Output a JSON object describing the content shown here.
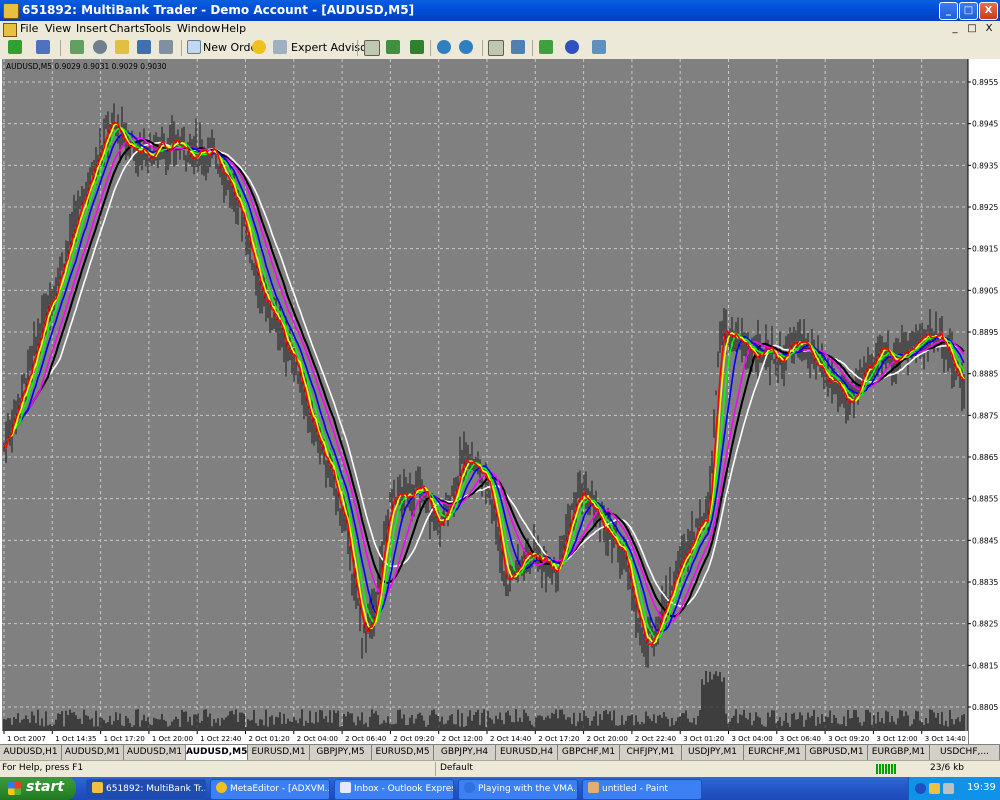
{
  "window": {
    "title": "651892: MultiBank Trader - Demo Account - [AUDUSD,M5]",
    "controls": [
      "_",
      "□",
      "X"
    ]
  },
  "menu": {
    "items": [
      "File",
      "View",
      "Insert",
      "Charts",
      "Tools",
      "Window",
      "Help"
    ],
    "mdi_controls": [
      "_",
      "□",
      "X"
    ]
  },
  "toolbar": {
    "new_order_label": "New Order",
    "expert_advisors_label": "Expert Advisors"
  },
  "chart": {
    "symbol_header": "AUDUSD,M5  0.9029 0.9031 0.9029 0.9030",
    "price_labels": [
      "0.8955",
      "0.8945",
      "0.8935",
      "0.8925",
      "0.8915",
      "0.8905",
      "0.8895",
      "0.8885",
      "0.8875",
      "0.8865",
      "0.8855",
      "0.8845",
      "0.8835",
      "0.8825",
      "0.8815",
      "0.8805"
    ],
    "time_labels": [
      "1 Oct 2007",
      "1 Oct 14:35",
      "1 Oct 17:20",
      "1 Oct 20:00",
      "1 Oct 22:40",
      "2 Oct 01:20",
      "2 Oct 04:00",
      "2 Oct 06:40",
      "2 Oct 09:20",
      "2 Oct 12:00",
      "2 Oct 14:40",
      "2 Oct 17:20",
      "2 Oct 20:00",
      "2 Oct 22:40",
      "3 Oct 01:20",
      "3 Oct 04:00",
      "3 Oct 06:40",
      "3 Oct 09:20",
      "3 Oct 12:00",
      "3 Oct 14:40"
    ],
    "colors": {
      "background": "#808080",
      "grid": "#c8c8c8",
      "candles": "#1a1a1a",
      "volume": "#282828",
      "ma_lines": [
        "#ffffff",
        "#000000",
        "#ff00ff",
        "#0000ff",
        "#00ff00",
        "#ffff00",
        "#ff0000"
      ]
    }
  },
  "tabs": [
    "AUDUSD,H1",
    "AUDUSD,M1",
    "AUDUSD,M1",
    "AUDUSD,M5",
    "EURUSD,M1",
    "GBPJPY,M5",
    "EURUSD,M5",
    "GBPJPY,H4",
    "EURUSD,H4",
    "GBPCHF,M1",
    "CHFJPY,M1",
    "USDJPY,M1",
    "EURCHF,M1",
    "GBPUSD,M1",
    "EURGBP,M1",
    "USDCHF,..."
  ],
  "active_tab": 3,
  "status": {
    "help": "For Help, press F1",
    "profile": "Default",
    "traffic": "23/6 kb"
  },
  "taskbar": {
    "start_label": "start",
    "tasks": [
      "651892: MultiBank Tr...",
      "MetaEditor - [ADXVM...",
      "Inbox - Outlook Express",
      "Playing with the VMA...",
      "untitled - Paint"
    ],
    "clock": "19:39"
  }
}
